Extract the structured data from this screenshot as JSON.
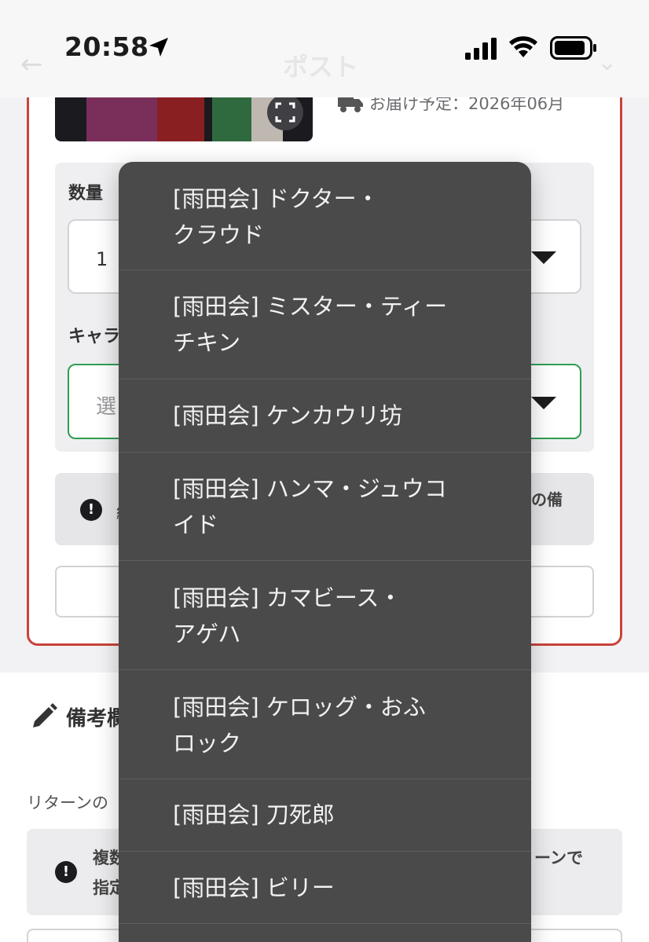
{
  "status_bar": {
    "time": "20:58"
  },
  "nav": {
    "back": "←",
    "title": "ポスト",
    "right": "⌄"
  },
  "product": {
    "delivery": "お届け予定：2026年06月"
  },
  "form": {
    "qty_label": "数量",
    "qty_value": "1",
    "chara_label": "キャラ",
    "chara_placeholder": "選",
    "notice_start": "結",
    "notice_end": "の備"
  },
  "notes": {
    "title": "備考欄",
    "return_text": "リターンの",
    "box_line1_start": "複数",
    "box_line2_start": "指定",
    "box_line1_end": "ーンで"
  },
  "picker": {
    "options": [
      {
        "label": "[雨田会] ドクター・\nクラウド"
      },
      {
        "label": "[雨田会] ミスター・ティー\nチキン"
      },
      {
        "label": "[雨田会] ケンカウリ坊"
      },
      {
        "label": "[雨田会] ハンマ・ジュウコ\nイド"
      },
      {
        "label": "[雨田会] カマビース・\nアゲハ"
      },
      {
        "label": "[雨田会] ケロッグ・おふ\nロック"
      },
      {
        "label": "[雨田会] 刀死郎"
      },
      {
        "label": "[雨田会] ビリー"
      }
    ]
  },
  "colors": {
    "card_border": "#c9433b",
    "focus_border": "#2f9e52",
    "picker_bg": "#4a4a4b"
  }
}
